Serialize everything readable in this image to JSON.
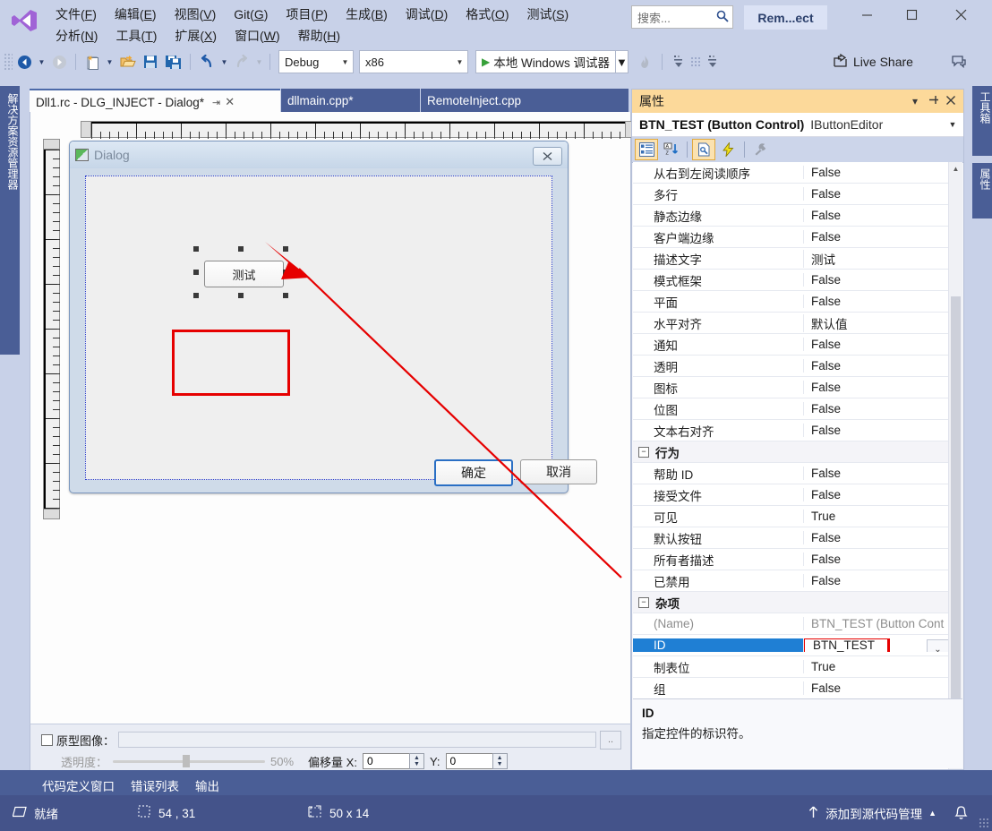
{
  "window": {
    "account_badge": "Rem...ect",
    "minimize": "─",
    "maximize": "☐",
    "close": "✕"
  },
  "search": {
    "placeholder": "搜索...",
    "icon": "search-icon"
  },
  "menu": {
    "row1": [
      {
        "label": "文件(F)",
        "pre": "文件(",
        "key": "F",
        "post": ")"
      },
      {
        "label": "编辑(E)",
        "pre": "编辑(",
        "key": "E",
        "post": ")"
      },
      {
        "label": "视图(V)",
        "pre": "视图(",
        "key": "V",
        "post": ")"
      },
      {
        "label": "Git(G)",
        "pre": "Git(",
        "key": "G",
        "post": ")"
      },
      {
        "label": "项目(P)",
        "pre": "项目(",
        "key": "P",
        "post": ")"
      },
      {
        "label": "生成(B)",
        "pre": "生成(",
        "key": "B",
        "post": ")"
      },
      {
        "label": "调试(D)",
        "pre": "调试(",
        "key": "D",
        "post": ")"
      },
      {
        "label": "格式(O)",
        "pre": "格式(",
        "key": "O",
        "post": ")"
      },
      {
        "label": "测试(S)",
        "pre": "测试(",
        "key": "S",
        "post": ")"
      }
    ],
    "row2": [
      {
        "label": "分析(N)",
        "pre": "分析(",
        "key": "N",
        "post": ")"
      },
      {
        "label": "工具(T)",
        "pre": "工具(",
        "key": "T",
        "post": ")"
      },
      {
        "label": "扩展(X)",
        "pre": "扩展(",
        "key": "X",
        "post": ")"
      },
      {
        "label": "窗口(W)",
        "pre": "窗口(",
        "key": "W",
        "post": ")"
      },
      {
        "label": "帮助(H)",
        "pre": "帮助(",
        "key": "H",
        "post": ")"
      }
    ]
  },
  "toolbar": {
    "config": "Debug",
    "platform": "x86",
    "run_label": "本地 Windows 调试器",
    "live_share": "Live Share"
  },
  "dock_tabs": {
    "left": "解决方案资源管理器",
    "right_top": "工具箱",
    "right_bottom": "属性"
  },
  "editor_tabs": [
    {
      "label": "Dll1.rc - DLG_INJECT - Dialog*",
      "active": true
    },
    {
      "label": "dllmain.cpp*",
      "active": false
    },
    {
      "label": "RemoteInject.cpp",
      "active": false
    }
  ],
  "dialog_preview": {
    "title": "Dialog",
    "close_glyph": "✕",
    "selected_button_text": "测试",
    "ok_label": "确定",
    "cancel_label": "取消"
  },
  "proto_image": {
    "checkbox_label": "原型图像：",
    "path_value": "",
    "browse_label": "..",
    "opacity_label": "透明度：",
    "opacity_value": "50%",
    "offset_label": "偏移量 X:",
    "offset_x": "0",
    "offset_y_label": "Y:",
    "offset_y": "0"
  },
  "properties": {
    "panel_title": "属性",
    "dropdown_glyph": "▾",
    "pin_glyph": "❐",
    "close_glyph": "✕",
    "selected_object": "BTN_TEST (Button Control)",
    "editor_name": "IButtonEditor",
    "toolbar_icons": [
      "categorized-icon",
      "alphabetical-icon",
      "properties-page-icon",
      "events-icon",
      "property-pages-icon"
    ],
    "rows": [
      {
        "key": "从右到左阅读顺序",
        "value": "False",
        "type": "prop"
      },
      {
        "key": "多行",
        "value": "False",
        "type": "prop"
      },
      {
        "key": "静态边缘",
        "value": "False",
        "type": "prop"
      },
      {
        "key": "客户端边缘",
        "value": "False",
        "type": "prop"
      },
      {
        "key": "描述文字",
        "value": "测试",
        "type": "prop"
      },
      {
        "key": "模式框架",
        "value": "False",
        "type": "prop"
      },
      {
        "key": "平面",
        "value": "False",
        "type": "prop"
      },
      {
        "key": "水平对齐",
        "value": "默认值",
        "type": "prop"
      },
      {
        "key": "通知",
        "value": "False",
        "type": "prop"
      },
      {
        "key": "透明",
        "value": "False",
        "type": "prop"
      },
      {
        "key": "图标",
        "value": "False",
        "type": "prop"
      },
      {
        "key": "位图",
        "value": "False",
        "type": "prop"
      },
      {
        "key": "文本右对齐",
        "value": "False",
        "type": "prop"
      },
      {
        "key": "行为",
        "value": "",
        "type": "category"
      },
      {
        "key": "帮助 ID",
        "value": "False",
        "type": "prop"
      },
      {
        "key": "接受文件",
        "value": "False",
        "type": "prop"
      },
      {
        "key": "可见",
        "value": "True",
        "type": "prop"
      },
      {
        "key": "默认按钮",
        "value": "False",
        "type": "prop"
      },
      {
        "key": "所有者描述",
        "value": "False",
        "type": "prop"
      },
      {
        "key": "已禁用",
        "value": "False",
        "type": "prop"
      },
      {
        "key": "杂项",
        "value": "",
        "type": "category"
      },
      {
        "key": "(Name)",
        "value": "BTN_TEST (Button Cont",
        "type": "readonly"
      },
      {
        "key": "ID",
        "value": "BTN_TEST",
        "type": "selected"
      },
      {
        "key": "制表位",
        "value": "True",
        "type": "prop"
      },
      {
        "key": "组",
        "value": "False",
        "type": "prop"
      }
    ],
    "description": {
      "title": "ID",
      "body": "指定控件的标识符。"
    }
  },
  "bottom_tabs": [
    "代码定义窗口",
    "错误列表",
    "输出"
  ],
  "status_bar": {
    "state": "就绪",
    "cursor_position": "54 , 31",
    "size": "50 x 14",
    "source_control": "添加到源代码管理",
    "source_control_arrow": "▲",
    "notify_icon": "bell-icon"
  },
  "colors": {
    "chrome": "#c8d1e8",
    "dock": "#4a5e96",
    "status": "#44538a",
    "props_header": "#fcd99a",
    "selection": "#1f7fd4",
    "annotation_red": "#e60000"
  }
}
